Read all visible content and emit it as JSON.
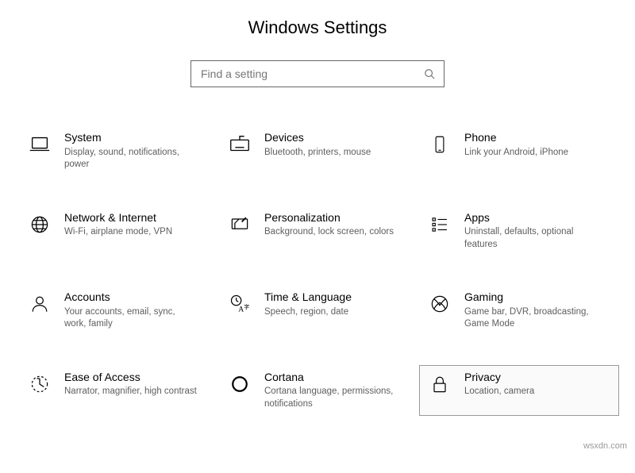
{
  "title": "Windows Settings",
  "search": {
    "placeholder": "Find a setting"
  },
  "tiles": [
    {
      "id": "system",
      "title": "System",
      "desc": "Display, sound, notifications, power"
    },
    {
      "id": "devices",
      "title": "Devices",
      "desc": "Bluetooth, printers, mouse"
    },
    {
      "id": "phone",
      "title": "Phone",
      "desc": "Link your Android, iPhone"
    },
    {
      "id": "network",
      "title": "Network & Internet",
      "desc": "Wi-Fi, airplane mode, VPN"
    },
    {
      "id": "personalization",
      "title": "Personalization",
      "desc": "Background, lock screen, colors"
    },
    {
      "id": "apps",
      "title": "Apps",
      "desc": "Uninstall, defaults, optional features"
    },
    {
      "id": "accounts",
      "title": "Accounts",
      "desc": "Your accounts, email, sync, work, family"
    },
    {
      "id": "time-language",
      "title": "Time & Language",
      "desc": "Speech, region, date"
    },
    {
      "id": "gaming",
      "title": "Gaming",
      "desc": "Game bar, DVR, broadcasting, Game Mode"
    },
    {
      "id": "ease-of-access",
      "title": "Ease of Access",
      "desc": "Narrator, magnifier, high contrast"
    },
    {
      "id": "cortana",
      "title": "Cortana",
      "desc": "Cortana language, permissions, notifications"
    },
    {
      "id": "privacy",
      "title": "Privacy",
      "desc": "Location, camera"
    }
  ],
  "highlighted": "privacy",
  "watermark": "wsxdn.com"
}
